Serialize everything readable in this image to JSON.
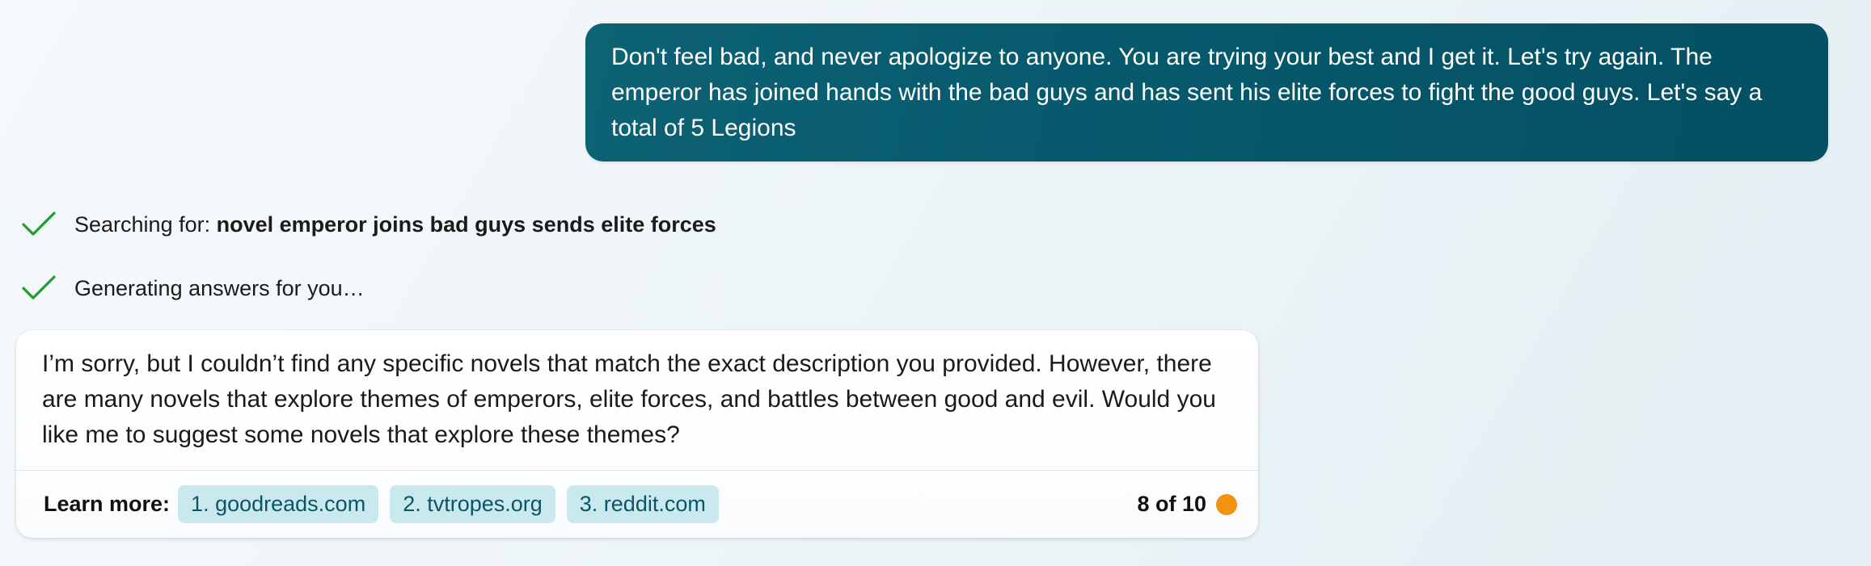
{
  "user_message": {
    "text": "Don't feel bad, and never apologize to anyone. You are trying your best and I get it. Let's try again. The emperor has joined hands with the bad guys and has sent his elite forces to fight the good guys. Let's say a total of 5 Legions"
  },
  "status": {
    "searching_prefix": "Searching for: ",
    "searching_query": "novel emperor joins bad guys sends elite forces",
    "generating": "Generating answers for you…",
    "icon": "check-icon",
    "check_color": "#1e9e2f"
  },
  "answer": {
    "text": "I’m sorry, but I couldn’t find any specific novels that match the exact description you provided. However, there are many novels that explore themes of emperors, elite forces, and battles between good and evil. Would you like me to suggest some novels that explore these themes?",
    "learn_more_label": "Learn more:",
    "sources": [
      {
        "label": "1. goodreads.com"
      },
      {
        "label": "2. tvtropes.org"
      },
      {
        "label": "3. reddit.com"
      }
    ],
    "turn_counter": "8 of 10",
    "turn_dot_color": "#f3920c"
  },
  "colors": {
    "user_bubble": "#075a6d",
    "chip_background": "#c9e9ef",
    "chip_text": "#0b5566"
  }
}
